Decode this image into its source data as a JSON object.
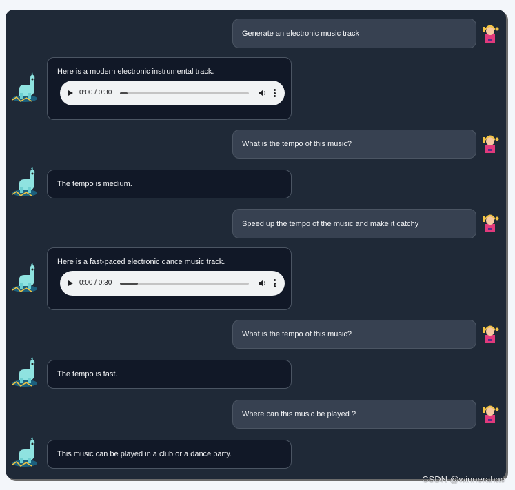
{
  "messages": [
    {
      "role": "user",
      "text": "Generate an electronic music track"
    },
    {
      "role": "bot",
      "text": "Here is a modern electronic instrumental track.",
      "audio": {
        "time": "0:00 / 0:30",
        "progress": 0.06
      }
    },
    {
      "role": "user",
      "text": "What is the tempo of this music?"
    },
    {
      "role": "bot",
      "text": "The tempo is medium."
    },
    {
      "role": "user",
      "text": "Speed up the tempo of the music and make it catchy"
    },
    {
      "role": "bot",
      "text": "Here is a fast-paced electronic dance music track.",
      "audio": {
        "time": "0:00 / 0:30",
        "progress": 0.14
      }
    },
    {
      "role": "user",
      "text": "What is the tempo of this music?"
    },
    {
      "role": "bot",
      "text": "The tempo is fast."
    },
    {
      "role": "user",
      "text": "Where can this music be played ?"
    },
    {
      "role": "bot",
      "text": "This music can be played in a club or a dance party."
    }
  ],
  "watermark": "CSDN @winnerahao",
  "icons": {
    "user_avatar": "user-avatar-icon",
    "bot_avatar": "llama-avatar-icon",
    "play": "play-icon",
    "volume": "volume-icon",
    "more": "more-options-icon"
  },
  "colors": {
    "panel": "#1f2937",
    "user_bubble": "#374151",
    "bot_bubble": "#111827",
    "border": "#4b5563",
    "player": "#f1f3f4"
  }
}
